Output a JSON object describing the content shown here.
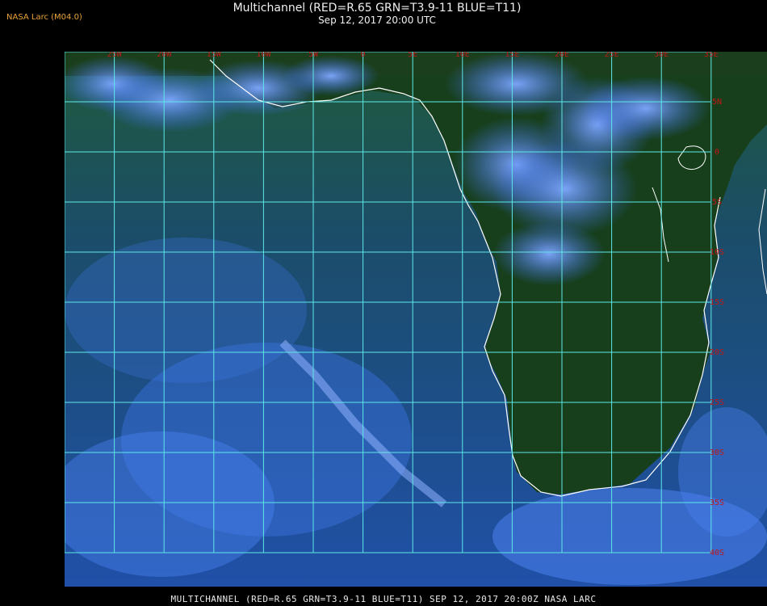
{
  "header": {
    "producer": "NASA Larc (M04.0)",
    "title": "Multichannel (RED=R.65 GRN=T3.9-11 BLUE=T11)",
    "datetime": "Sep 12, 2017 20:00 UTC"
  },
  "footer": {
    "caption": "MULTICHANNEL (RED=R.65 GRN=T3.9-11 BLUE=T11) SEP 12, 2017 20:00Z  NASA LARC"
  },
  "map": {
    "longitude_labels": [
      "25W",
      "20W",
      "15W",
      "10W",
      "5W",
      "0",
      "5E",
      "10E",
      "15E",
      "20E",
      "25E",
      "30E",
      "35E"
    ],
    "latitude_labels": [
      "5N",
      "0",
      "5S",
      "10S",
      "15S",
      "20S",
      "25S",
      "30S",
      "35S",
      "40S"
    ],
    "colors": {
      "grid": "#5ee8e8",
      "grid_label": "#c21818",
      "coastline": "#ffffff",
      "ocean": "#1a4a7a",
      "land": "#16401c",
      "cloud": "#5a8cff"
    }
  }
}
